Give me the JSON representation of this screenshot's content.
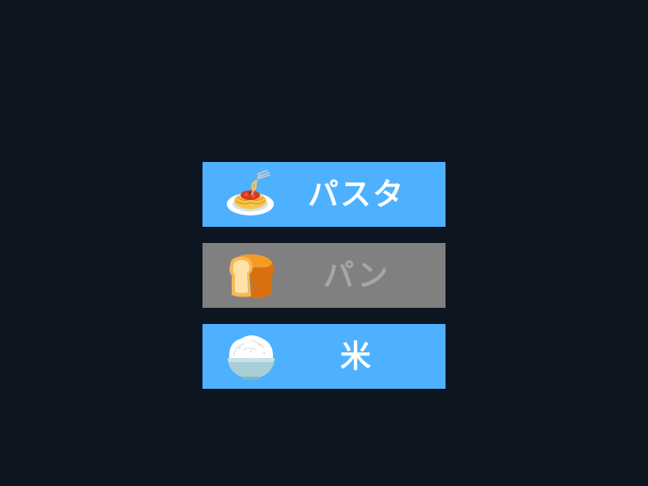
{
  "menu": {
    "items": [
      {
        "label": "パスタ",
        "icon": "spaghetti-icon",
        "enabled": true
      },
      {
        "label": "パン",
        "icon": "bread-icon",
        "enabled": false
      },
      {
        "label": "米",
        "icon": "rice-bowl-icon",
        "enabled": true
      }
    ]
  },
  "colors": {
    "background": "#0d1520",
    "button_enabled": "#4db1ff",
    "button_disabled": "#808080",
    "label_enabled": "#ffffff",
    "label_disabled": "#a6a6a6"
  }
}
